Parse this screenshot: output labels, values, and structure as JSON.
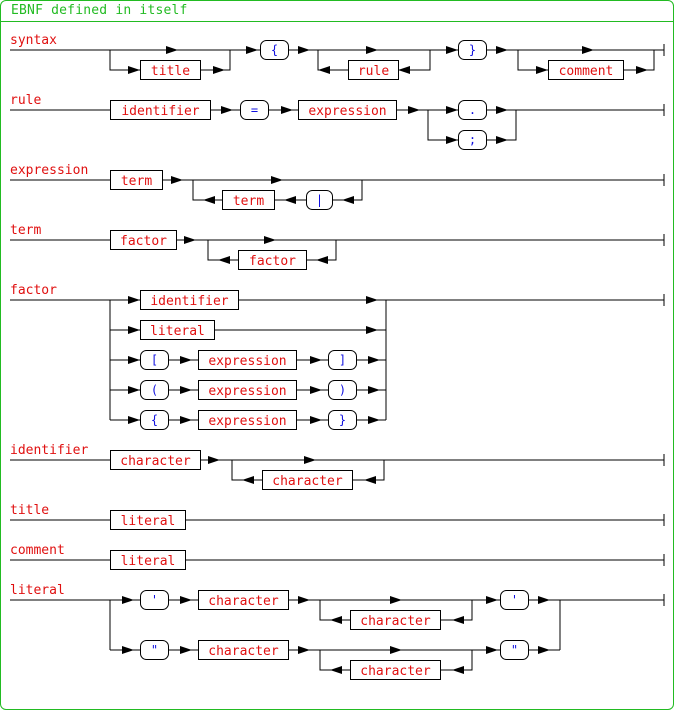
{
  "title": "EBNF defined in itself",
  "colors": {
    "frame": "#22bb22",
    "nonterminal_text": "#e01010",
    "terminal_text": "#1010e0",
    "line": "#000000"
  },
  "rules": [
    {
      "name": "syntax",
      "nonterminals": [
        "title",
        "rule",
        "comment"
      ],
      "terminals": [
        "{",
        "}"
      ]
    },
    {
      "name": "rule",
      "nonterminals": [
        "identifier",
        "expression"
      ],
      "terminals": [
        "=",
        ".",
        ";"
      ]
    },
    {
      "name": "expression",
      "nonterminals": [
        "term",
        "term"
      ],
      "terminals": [
        "|"
      ]
    },
    {
      "name": "term",
      "nonterminals": [
        "factor",
        "factor"
      ],
      "terminals": []
    },
    {
      "name": "factor",
      "nonterminals": [
        "identifier",
        "literal",
        "expression",
        "expression",
        "expression"
      ],
      "terminals": [
        "[",
        "]",
        "(",
        ")",
        "{",
        "}"
      ]
    },
    {
      "name": "identifier",
      "nonterminals": [
        "character",
        "character"
      ],
      "terminals": []
    },
    {
      "name": "title",
      "nonterminals": [
        "literal"
      ],
      "terminals": []
    },
    {
      "name": "comment",
      "nonterminals": [
        "literal"
      ],
      "terminals": []
    },
    {
      "name": "literal",
      "nonterminals": [
        "character",
        "character",
        "character",
        "character"
      ],
      "terminals": [
        "'",
        "'",
        "\"",
        "\""
      ]
    }
  ]
}
